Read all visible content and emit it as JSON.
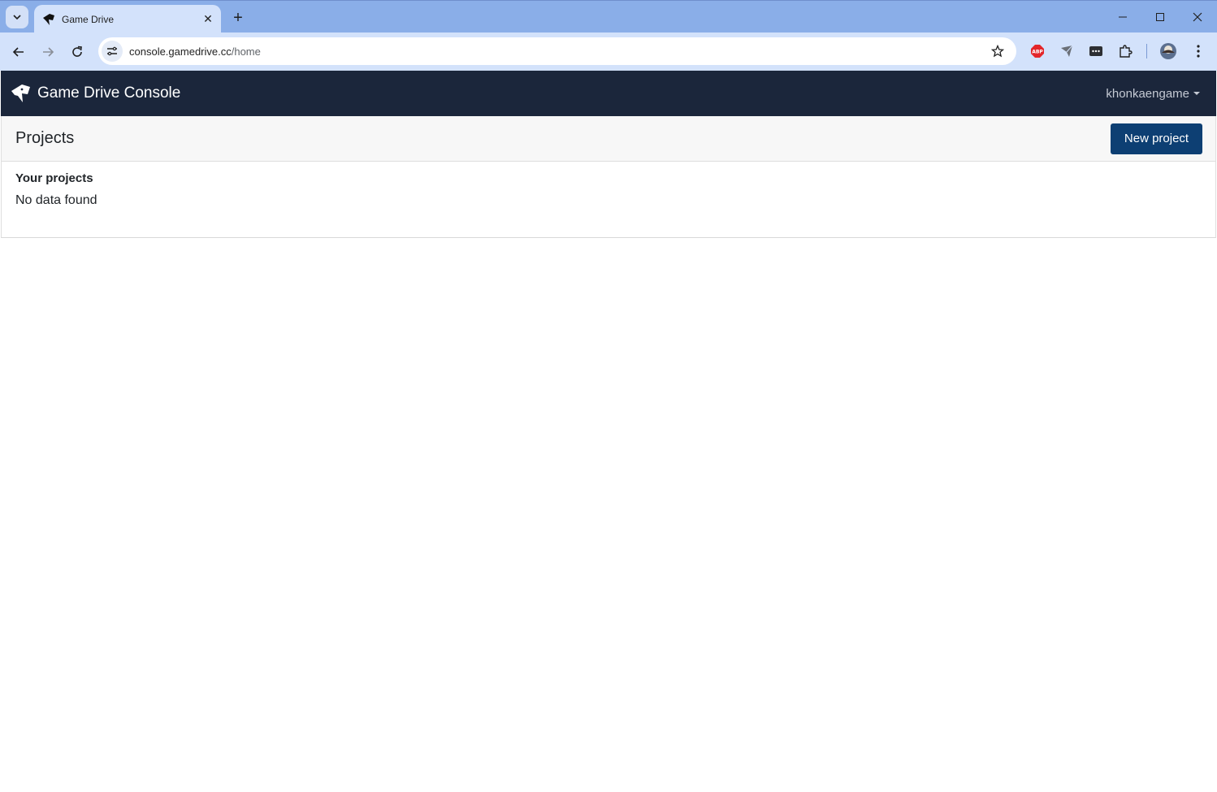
{
  "browser": {
    "tab_title": "Game Drive",
    "url_host": "console.gamedrive.cc",
    "url_path": "/home",
    "new_tab_symbol": "+",
    "close_symbol": "✕",
    "extensions": [
      "abp-icon",
      "paper-plane-icon",
      "password-manager-icon",
      "puzzle-icon"
    ],
    "abp_label": "ABP"
  },
  "app": {
    "brand": "Game Drive Console",
    "user": "khonkaengame",
    "accent_color": "#1b263b",
    "button_color": "#0d3f73"
  },
  "projects": {
    "title": "Projects",
    "new_button": "New project",
    "section_label": "Your projects",
    "empty_message": "No data found"
  }
}
